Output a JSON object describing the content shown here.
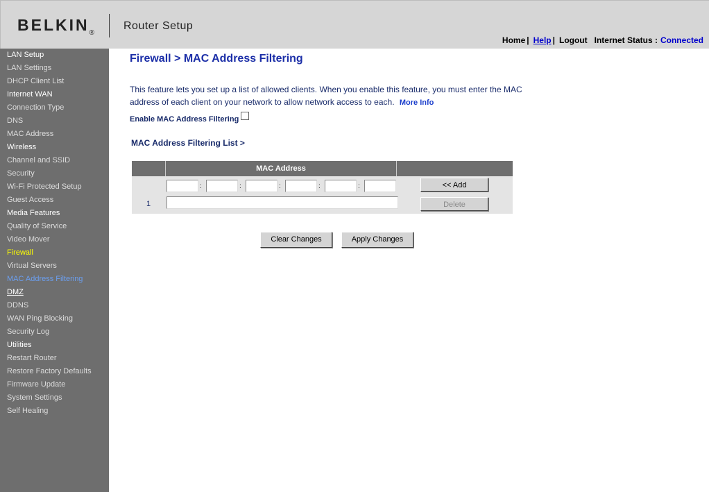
{
  "header": {
    "logo": "BELKIN",
    "logo_mark": "®",
    "app_title": "Router Setup",
    "nav": {
      "home": "Home",
      "help": "Help",
      "logout": "Logout",
      "status_label": "Internet Status :",
      "status_value": "Connected",
      "separator": "|"
    }
  },
  "sidebar": {
    "items": [
      {
        "label": "LAN Setup",
        "kind": "section"
      },
      {
        "label": "LAN Settings",
        "kind": "item"
      },
      {
        "label": "DHCP Client List",
        "kind": "item"
      },
      {
        "label": "Internet WAN",
        "kind": "section"
      },
      {
        "label": "Connection Type",
        "kind": "item"
      },
      {
        "label": "DNS",
        "kind": "item"
      },
      {
        "label": "MAC Address",
        "kind": "item"
      },
      {
        "label": "Wireless",
        "kind": "section"
      },
      {
        "label": "Channel and SSID",
        "kind": "item"
      },
      {
        "label": "Security",
        "kind": "item"
      },
      {
        "label": "Wi-Fi Protected Setup",
        "kind": "item"
      },
      {
        "label": "Guest Access",
        "kind": "item"
      },
      {
        "label": "Media Features",
        "kind": "section"
      },
      {
        "label": "Quality of Service",
        "kind": "item"
      },
      {
        "label": "Video Mover",
        "kind": "item"
      },
      {
        "label": "Firewall",
        "kind": "active-section"
      },
      {
        "label": "Virtual Servers",
        "kind": "item"
      },
      {
        "label": "MAC Address Filtering",
        "kind": "current"
      },
      {
        "label": "DMZ",
        "kind": "underline"
      },
      {
        "label": "DDNS",
        "kind": "item"
      },
      {
        "label": "WAN Ping Blocking",
        "kind": "item"
      },
      {
        "label": "Security Log",
        "kind": "item"
      },
      {
        "label": "Utilities",
        "kind": "section"
      },
      {
        "label": "Restart Router",
        "kind": "item"
      },
      {
        "label": "Restore Factory Defaults",
        "kind": "item"
      },
      {
        "label": "Firmware Update",
        "kind": "item"
      },
      {
        "label": "System Settings",
        "kind": "item"
      },
      {
        "label": "Self Healing",
        "kind": "item"
      }
    ]
  },
  "main": {
    "title": "Firewall > MAC Address Filtering",
    "description": "This feature lets you set up a list of allowed clients. When you enable this feature, you must enter the MAC address of each client on your network to allow network access to each.",
    "more_info": "More Info",
    "enable_label": "Enable MAC Address Filtering",
    "enable_checked": false,
    "list_title": "MAC Address Filtering List >",
    "table": {
      "header_mac": "MAC Address",
      "colon": ":",
      "entry_number": "1",
      "add_button": "<< Add",
      "delete_button": "Delete"
    },
    "clear_button": "Clear Changes",
    "apply_button": "Apply Changes"
  }
}
